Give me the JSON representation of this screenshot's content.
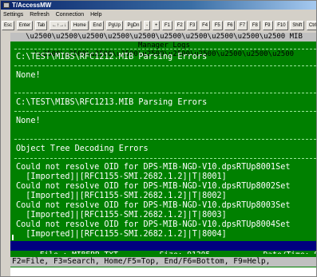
{
  "window": {
    "title": "T/AccessMW"
  },
  "menu": {
    "items": [
      "Settings",
      "Refresh",
      "Connection",
      "Help"
    ]
  },
  "toolbar": {
    "buttons": [
      "Esc",
      "Enter",
      "Tab",
      "←↑→↓",
      "Home",
      "End",
      "PgUp",
      "PgDn",
      "-",
      "+",
      "F1",
      "F2",
      "F3",
      "F4",
      "F5",
      "F6",
      "F7",
      "F8",
      "F9",
      "F10",
      "Shift",
      "Ctrl"
    ]
  },
  "terminal": {
    "header": "MIB Manager Logs",
    "section1": {
      "title": "C:\\TEST\\MIBS\\RFC1212.MIB Parsing Errors",
      "body": "None!"
    },
    "section2": {
      "title": "C:\\TEST\\MIBS\\RFC1213.MIB Parsing Errors",
      "body": "None!"
    },
    "section3": {
      "title": "Object Tree Decoding Errors",
      "lines": [
        "Could not resolve OID for DPS-MIB-NGD-V10.dpsRTUp8001Set",
        "  [Imported]|[RFC1155-SMI.2682.1.2]|T|8001]",
        "Could not resolve OID for DPS-MIB-NGD-V10.dpsRTUp8002Set",
        "  [Imported]|[RFC1155-SMI.2682.1.2]|T|8002]",
        "Could not resolve OID for DPS-MIB-NGD-V10.dpsRTUp8003Set",
        "  [Imported]|[RFC1155-SMI.2682.1.2]|T|8003]",
        "Could not resolve OID for DPS-MIB-NGD-V10.dpsRTUp8004Set",
        "  [Imported]|[RFC1155-SMI.2682.1.2]|T|8004]"
      ]
    },
    "status": {
      "file": "File : MIBERR.TXT",
      "size": "Size: 91205",
      "datetime": "Date/Time: Sep"
    },
    "function_keys": "F2=File, F3=Search, Home/F5=Top, End/F6=Bottom, F9=Help,"
  },
  "colors": {
    "terminal_bg": "#008000",
    "header_bg": "#c0c0c0",
    "status_bg": "#000080"
  }
}
